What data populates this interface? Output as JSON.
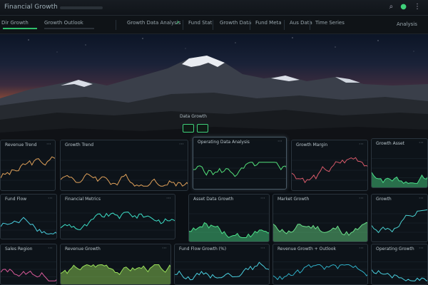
{
  "window": {
    "title": "Financial Growth",
    "icons": {
      "search": "magnifier-icon",
      "status": "status-dot-icon",
      "more": "more-icon"
    }
  },
  "menubar": {
    "items": [
      "Dir Growth",
      "Growth Outlook",
      "Growth Data Analysis",
      "Fund Stat",
      "Growth Data",
      "Fund Meta",
      "Aus Data",
      "Time Series"
    ],
    "right_label": "Analysis"
  },
  "hero": {
    "badge_label": "Data Growth"
  },
  "panels": [
    {
      "title": "Revenue Trend",
      "line_color": "#e0a15a"
    },
    {
      "title": "Growth Trend",
      "line_color": "#e0a15a"
    },
    {
      "title": "Operating Data Analysis",
      "line_color": "#53e27a"
    },
    {
      "title": "Growth Margin",
      "line_color": "#d95a6a"
    },
    {
      "title": "Growth Asset",
      "line_color": "#4be08a"
    },
    {
      "title": "Fund Flow",
      "line_color": "#4ad0e0"
    },
    {
      "title": "Financial Metrics",
      "line_color": "#3ce0c8"
    },
    {
      "title": "Asset Data Growth",
      "line_color": "#4be08a"
    },
    {
      "title": "Market Growth",
      "line_color": "#6ae08a"
    },
    {
      "title": "Growth",
      "line_color": "#4ad0d0"
    },
    {
      "title": "Sales Region",
      "line_color": "#d95a9a"
    },
    {
      "title": "Revenue Growth",
      "line_color": "#9ae05a"
    },
    {
      "title": "Fund Flow Growth (%)",
      "line_color": "#4ad0e0"
    },
    {
      "title": "Revenue Growth + Outlook",
      "line_color": "#2fb0c8"
    },
    {
      "title": "Operating Growth",
      "line_color": "#4ad0e0"
    }
  ]
}
